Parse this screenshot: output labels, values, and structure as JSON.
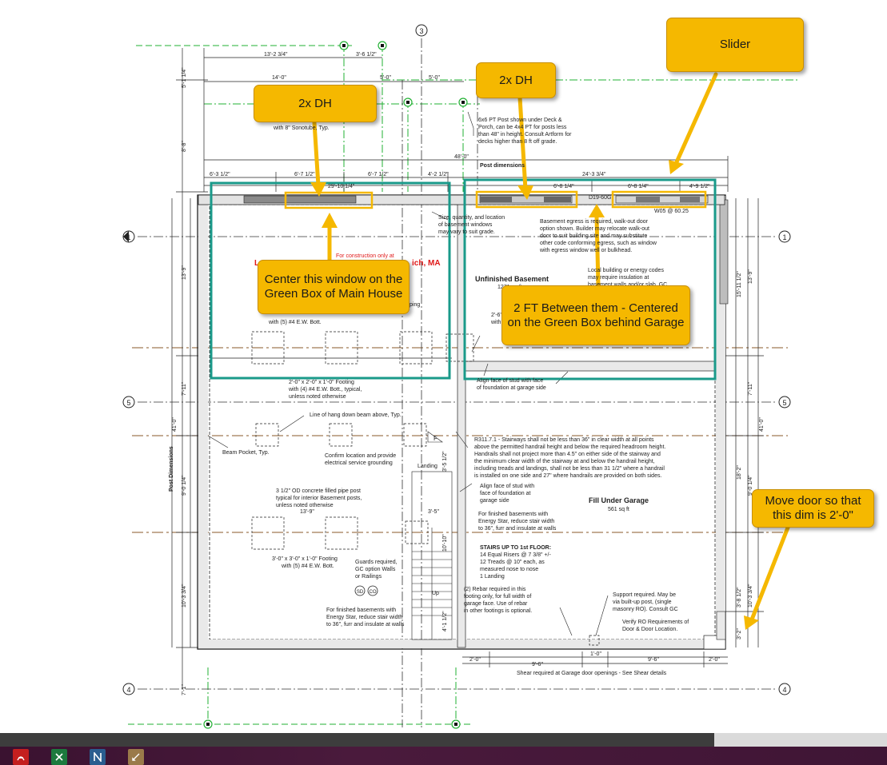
{
  "callouts": {
    "c1": "2x DH",
    "c2": "2x DH",
    "c3": "Slider",
    "c4": "Center this window on the Green Box of Main House",
    "c5": "2 FT Between them - Centered on the Green Box behind Garage",
    "c6": "Move door so that this dim is 2'-0\""
  },
  "grid": {
    "g1": "1",
    "g3": "3",
    "g4": "4",
    "g5": "5"
  },
  "dims": {
    "d1": "13'-2 3/4\"",
    "d2": "3'-6 1/2\"",
    "d3": "14'-0\"",
    "d4": "5'-0\"",
    "d5": "5'-0\"",
    "overall": "48'-0\"",
    "post_dim": "Post dimensions",
    "d6": "6'-3 1/2\"",
    "d7": "6'-7 1/2\"",
    "d8": "6'-7 1/2\"",
    "d9": "4'-2 1/2\"",
    "d10": "24'-3 3/4\"",
    "d11": "29'-10 1/4\"",
    "d12": "6'-8 1/4\"",
    "d13": "6'-8 1/4\"",
    "d14": "4'-9 1/2\"",
    "window_tag": "D19-60G",
    "window_tag2": "W05 @ 60.25",
    "left1": "5'-1 1/4\"",
    "left2": "8'-8\"",
    "left3": "13'-9\"",
    "left4": "7'-11\"",
    "left5": "41'-0\"",
    "left6": "9'-0 1/4\"",
    "left7": "10'-3 3/4\"",
    "left8": "7'-1\"",
    "right1": "13'-9\"",
    "right2": "15'-11 1/2\"",
    "right3": "7'-11\"",
    "right4": "41'-0\"",
    "right5": "18'-2\"",
    "right6": "9'-0 1/4\"",
    "right7": "10'-3 3/4\"",
    "right8": "3'-8 1/2\"",
    "right9": "3'-2\"",
    "b1": "2'-0\"",
    "b2": "9'-6\"",
    "b3": "1'-0\"",
    "b4": "9'-6\"",
    "b5": "2'-0\"",
    "stair1": "3'-5 1/2\"",
    "stair2": "3'-5\"",
    "stair3": "10'-10\"",
    "stair4": "4'-1 1/2\"",
    "s1": "13'-9\"",
    "post_dim_v": "Post Dimensions"
  },
  "notes": {
    "sono": "with 8\" Sonotube, Typ.",
    "post1": "6x6 PT Post shown under Deck &",
    "post2": "Porch, can be 4x4 PT for posts less",
    "post3": "than 48\" in height. Consult Artform for",
    "post4": "decks higher than 8 ft off grade.",
    "size1": "Size, quantity, and location",
    "size2": "of basement windows",
    "size3": "may vary to suit grade.",
    "egress1": "Basement egress is required, walk-out door",
    "egress2": "option shown. Builder may relocate walk-out",
    "egress3": "door to suit building site and may substitute",
    "egress4": "other code conforming egress, such as window",
    "egress5": "with egress window well or bulkhead.",
    "red_note": "For construction only at",
    "red_l": "L",
    "red_r": "ich, MA",
    "local1": "Local building or energy codes",
    "local2": "may require insulation at",
    "local3": "basement walls and/or slab. GC",
    "unfinished": "Unfinished Basement",
    "unf_area": "1271 sq ft",
    "ftg1": "with (5) #4 E.W. Bott.",
    "ftg2": "2'-6\"",
    "ftg3": "with",
    "ftg4": "ping",
    "align1": "Align face of stud with face",
    "align2": "of foundation at garage side",
    "ftg_a1": "2'-0\" x 2'-0\" x 1'-0\" Footing",
    "ftg_a2": "with (4) #4 E.W. Bott., typical,",
    "ftg_a3": "unless noted otherwise",
    "hang": "Line of hang down beam above, Typ.",
    "pocket": "Beam Pocket, Typ.",
    "confirm1": "Confirm location and provide",
    "confirm2": "electrical service grounding",
    "r311_1": "R311.7.1 - Stairways shall not be less than 36\" in clear width at all points",
    "r311_2": "above the permitted handrail height and below the required headroom height.",
    "r311_3": "Handrails shall not project more than 4.5\" on either side of the stairway and",
    "r311_4": "the minimum clear width of the stairway at and below the handrail height,",
    "r311_5": "including treads and landings, shall not be less than 31 1/2\" where a handrail",
    "r311_6": "is installed on one side and 27\" where handrails are provided on both sides.",
    "landing": "Landing",
    "pipe1": "3 1/2\" OD concrete filled pipe post",
    "pipe2": "typical for interior Basement posts,",
    "pipe3": "unless noted otherwise",
    "align_g1": "Align face of stud with",
    "align_g2": "face of foundation at",
    "align_g3": "garage side",
    "fin1": "For finished basements with",
    "fin2": "Energy Star, reduce stair width",
    "fin3": "to 36\", furr and insulate at walls",
    "fill_under": "Fill Under Garage",
    "fill_area": "561 sq ft",
    "ftg_b1": "3'-0\" x 3'-0\" x 1'-0\" Footing",
    "ftg_b2": "with (5) #4 E.W. Bott.",
    "guards1": "Guards required,",
    "guards2": "GC option Walls",
    "guards3": "or Railings",
    "stairs1": "STAIRS UP TO 1st FLOOR:",
    "stairs2": "14 Equal Risers @ 7 3/8\" +/-",
    "stairs3": "12 Treads @ 10\" each, as",
    "stairs4": "measured nose to nose",
    "stairs5": "1 Landing",
    "rebar1": "(2) Rebar required in this",
    "rebar2": "footing only, for full width of",
    "rebar3": "garage face.  Use of rebar",
    "rebar4": "in other footings is optional.",
    "support1": "Support required.  May be",
    "support2": "via built-up post, (single",
    "support3": "masonry RO).  Consult GC",
    "up": "Up",
    "sd": "SD",
    "co": "CO",
    "fin_b1": "For finished basements with",
    "fin_b2": "Energy Star, reduce stair width",
    "fin_b3": "to 36\", furr and insulate at walls",
    "verify1": "Verify RO Requirements of",
    "verify2": "Door & Door Location.",
    "shear": "Shear required at Garage door openings - See Shear details",
    "stair_tag": "F"
  },
  "colors": {
    "callout": "#f5b800",
    "teal_box": "#1a9a8a",
    "grid_green": "#22b033",
    "grid_brown": "#8a5a2a",
    "red_text": "#e01818"
  },
  "taskbar_icons": [
    "pdf-icon",
    "excel-icon",
    "app-n-icon",
    "app-pencil-icon"
  ]
}
